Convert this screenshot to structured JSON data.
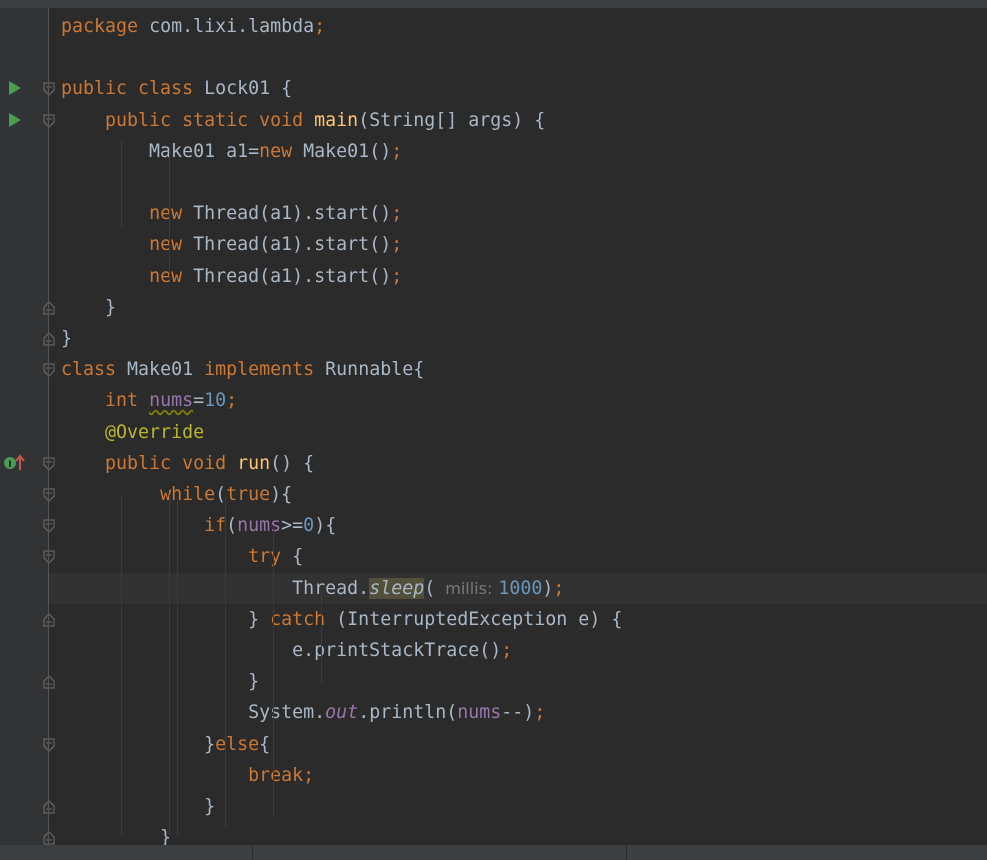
{
  "editor": {
    "language": "Java",
    "lines": [
      {
        "parts": [
          [
            "kw",
            "package "
          ],
          [
            "p",
            "com.lixi.lambda"
          ],
          [
            "kw",
            ";"
          ]
        ]
      },
      {
        "parts": []
      },
      {
        "parts": [
          [
            "kw",
            "public class "
          ],
          [
            "p",
            "Lock01 {"
          ]
        ]
      },
      {
        "parts": [
          [
            "p",
            "    "
          ],
          [
            "kw",
            "public static void "
          ],
          [
            "fn",
            "main"
          ],
          [
            "p",
            "(String[] args) {"
          ]
        ]
      },
      {
        "parts": [
          [
            "p",
            "        Make01 a1="
          ],
          [
            "kw",
            "new "
          ],
          [
            "p",
            "Make01()"
          ],
          [
            "kw",
            ";"
          ]
        ]
      },
      {
        "parts": []
      },
      {
        "parts": [
          [
            "p",
            "        "
          ],
          [
            "kw",
            "new "
          ],
          [
            "p",
            "Thread(a1).start()"
          ],
          [
            "kw",
            ";"
          ]
        ]
      },
      {
        "parts": [
          [
            "p",
            "        "
          ],
          [
            "kw",
            "new "
          ],
          [
            "p",
            "Thread(a1).start()"
          ],
          [
            "kw",
            ";"
          ]
        ]
      },
      {
        "parts": [
          [
            "p",
            "        "
          ],
          [
            "kw",
            "new "
          ],
          [
            "p",
            "Thread(a1).start()"
          ],
          [
            "kw",
            ";"
          ]
        ]
      },
      {
        "parts": [
          [
            "p",
            "    }"
          ]
        ]
      },
      {
        "parts": [
          [
            "p",
            "}"
          ]
        ]
      },
      {
        "parts": [
          [
            "kw",
            "class "
          ],
          [
            "p",
            "Make01 "
          ],
          [
            "kw",
            "implements "
          ],
          [
            "p",
            "Runnable{"
          ]
        ]
      },
      {
        "parts": [
          [
            "p",
            "    "
          ],
          [
            "kw",
            "int "
          ],
          [
            "fieldwarn",
            "nums"
          ],
          [
            "p",
            "="
          ],
          [
            "num",
            "10"
          ],
          [
            "kw",
            ";"
          ]
        ]
      },
      {
        "parts": [
          [
            "p",
            "    "
          ],
          [
            "ann",
            "@Override"
          ]
        ]
      },
      {
        "parts": [
          [
            "p",
            "    "
          ],
          [
            "kw",
            "public void "
          ],
          [
            "fn",
            "run"
          ],
          [
            "p",
            "() {"
          ]
        ]
      },
      {
        "parts": [
          [
            "p",
            "         "
          ],
          [
            "kw",
            "while"
          ],
          [
            "p",
            "("
          ],
          [
            "kw",
            "true"
          ],
          [
            "p",
            "){"
          ]
        ]
      },
      {
        "parts": [
          [
            "p",
            "             "
          ],
          [
            "kw",
            "if"
          ],
          [
            "p",
            "("
          ],
          [
            "field",
            "nums"
          ],
          [
            "p",
            ">="
          ],
          [
            "num",
            "0"
          ],
          [
            "p",
            "){"
          ]
        ]
      },
      {
        "parts": [
          [
            "p",
            "                 "
          ],
          [
            "kw",
            "try "
          ],
          [
            "p",
            "{"
          ]
        ]
      },
      {
        "parts": [
          [
            "p",
            "                     Thread."
          ],
          [
            "statichl",
            "sleep"
          ],
          [
            "p",
            "("
          ],
          [
            "hint",
            "millis:"
          ],
          [
            "num",
            "1000"
          ],
          [
            "p",
            ")"
          ],
          [
            "kw",
            ";"
          ]
        ]
      },
      {
        "parts": [
          [
            "p",
            "                 } "
          ],
          [
            "kw",
            "catch "
          ],
          [
            "p",
            "(InterruptedException e) {"
          ]
        ]
      },
      {
        "parts": [
          [
            "p",
            "                     e.printStackTrace()"
          ],
          [
            "kw",
            ";"
          ]
        ]
      },
      {
        "parts": [
          [
            "p",
            "                 }"
          ]
        ]
      },
      {
        "parts": [
          [
            "p",
            "                 System."
          ],
          [
            "fieldit",
            "out"
          ],
          [
            "p",
            ".println("
          ],
          [
            "field",
            "nums"
          ],
          [
            "p",
            "--)"
          ],
          [
            "kw",
            ";"
          ]
        ]
      },
      {
        "parts": [
          [
            "p",
            "             }"
          ],
          [
            "kw",
            "else"
          ],
          [
            "p",
            "{"
          ]
        ]
      },
      {
        "parts": [
          [
            "p",
            "                 "
          ],
          [
            "kw",
            "break;"
          ]
        ]
      },
      {
        "parts": [
          [
            "p",
            "             }"
          ]
        ]
      },
      {
        "parts": [
          [
            "p",
            "         }"
          ]
        ]
      }
    ],
    "current_line_index": 18,
    "gutter_markers": [
      {
        "line": 2,
        "type": "run-icon"
      },
      {
        "line": 3,
        "type": "run-icon"
      },
      {
        "line": 14,
        "type": "implements-icon"
      }
    ],
    "fold_markers": [
      {
        "line": 2,
        "type": "fold-open"
      },
      {
        "line": 3,
        "type": "fold-open"
      },
      {
        "line": 9,
        "type": "fold-close"
      },
      {
        "line": 10,
        "type": "fold-close"
      },
      {
        "line": 11,
        "type": "fold-open"
      },
      {
        "line": 14,
        "type": "fold-open"
      },
      {
        "line": 15,
        "type": "fold-open"
      },
      {
        "line": 16,
        "type": "fold-open"
      },
      {
        "line": 17,
        "type": "fold-open"
      },
      {
        "line": 19,
        "type": "fold-close"
      },
      {
        "line": 21,
        "type": "fold-close"
      },
      {
        "line": 23,
        "type": "fold-open"
      },
      {
        "line": 25,
        "type": "fold-close"
      },
      {
        "line": 26,
        "type": "fold-close"
      }
    ],
    "colors": {
      "background": "#2b2b2b",
      "gutter": "#313335",
      "keyword": "#cc7832",
      "plain": "#a9b7c6",
      "function": "#ffc66d",
      "number": "#6897bb",
      "field": "#9876aa",
      "annotation": "#bbb529",
      "current_line": "#323232"
    }
  }
}
